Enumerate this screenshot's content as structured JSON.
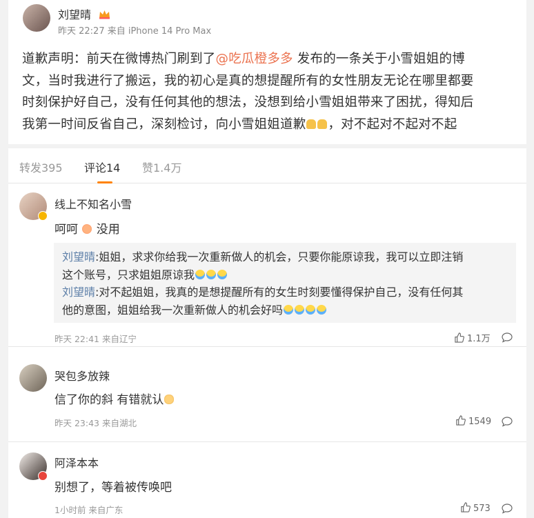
{
  "post": {
    "author": "刘望晴",
    "meta": "昨天 22:27 来自 iPhone 14 Pro Max",
    "text_lines": [
      {
        "before": "道歉声明：前天在微博热门刷到了",
        "mention": "@吃瓜橙多多",
        "after": " 发布的一条关于小雪姐姐的博"
      },
      {
        "text": "文，当时我进行了搬运，我的初心是真的想提醒所有的女性朋友无论在哪里都要"
      },
      {
        "text": "时刻保护好自己，没有任何其他的想法，没想到给小雪姐姐带来了困扰，得知后"
      },
      {
        "before": "我第一时间反省自己，深刻检讨，向小雪姐姐道歉",
        "after": "，对不起对不起对不起"
      }
    ]
  },
  "tabs": [
    {
      "label": "转发395"
    },
    {
      "label": "评论14"
    },
    {
      "label": "赞1.4万"
    }
  ],
  "comments": [
    {
      "name": "线上不知名小雪",
      "text_before": "呵呵",
      "text_after": " 没用",
      "replies": [
        {
          "author": "刘望晴",
          "line1": ":姐姐，求求你给我一次重新做人的机会，只要你能原谅我，我可以立即注销",
          "line2": "这个账号，只求姐姐原谅我"
        },
        {
          "author": "刘望晴",
          "line1": ":对不起姐姐，我真的是想提醒所有的女生时刻要懂得保护自己，没有任何其",
          "line2": "他的意图，姐姐给我一次重新做人的机会好吗"
        }
      ],
      "meta": "昨天 22:41 来自辽宁",
      "likes": "1.1万"
    },
    {
      "name": "哭包多放辣",
      "text_before": "信了你的斜 有错就认",
      "meta": "昨天 23:43 来自湖北",
      "likes": "1549"
    },
    {
      "name": "阿泽本本",
      "text_before": "别想了，等着被传唤吧",
      "meta": "1小时前 来自广东",
      "likes": "573"
    }
  ],
  "colors": {
    "mention": "#eb7350",
    "reply_author": "#5d7fa8",
    "tab_active_underline": "#ff8200"
  }
}
